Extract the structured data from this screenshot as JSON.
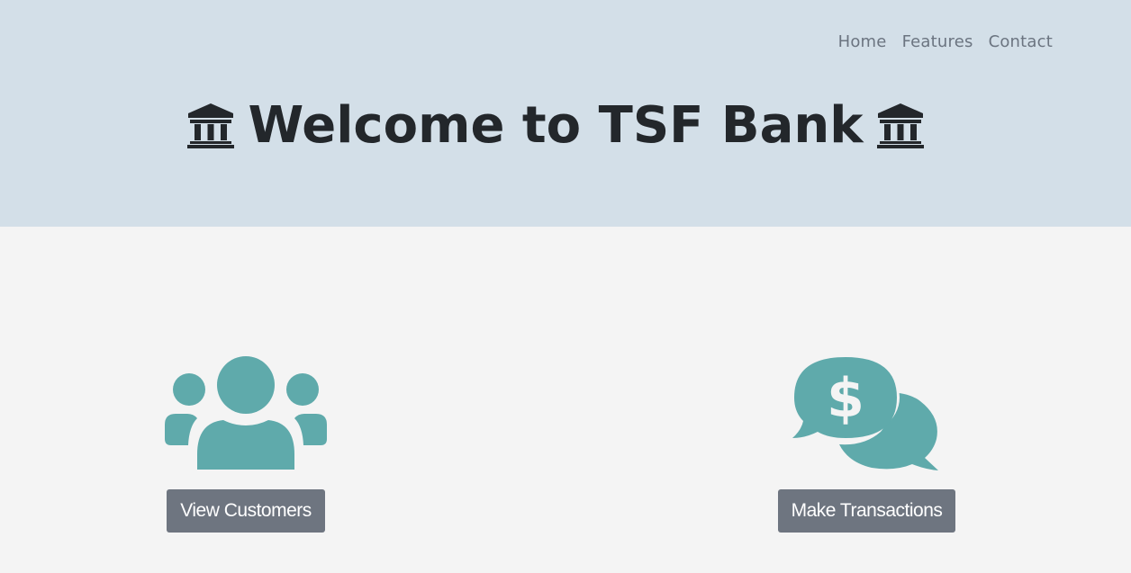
{
  "nav": {
    "items": [
      {
        "label": "Home"
      },
      {
        "label": "Features"
      },
      {
        "label": "Contact"
      }
    ]
  },
  "header": {
    "title": "Welcome to TSF Bank"
  },
  "features": {
    "customers": {
      "icon": "users-icon",
      "button_label": "View Customers"
    },
    "transactions": {
      "icon": "money-chat-icon",
      "button_label": "Make Transactions"
    }
  },
  "colors": {
    "hero_background": "#d3dfe8",
    "page_background": "#f4f4f4",
    "icon_teal": "#5faaab",
    "button_gray": "#6e7580"
  }
}
